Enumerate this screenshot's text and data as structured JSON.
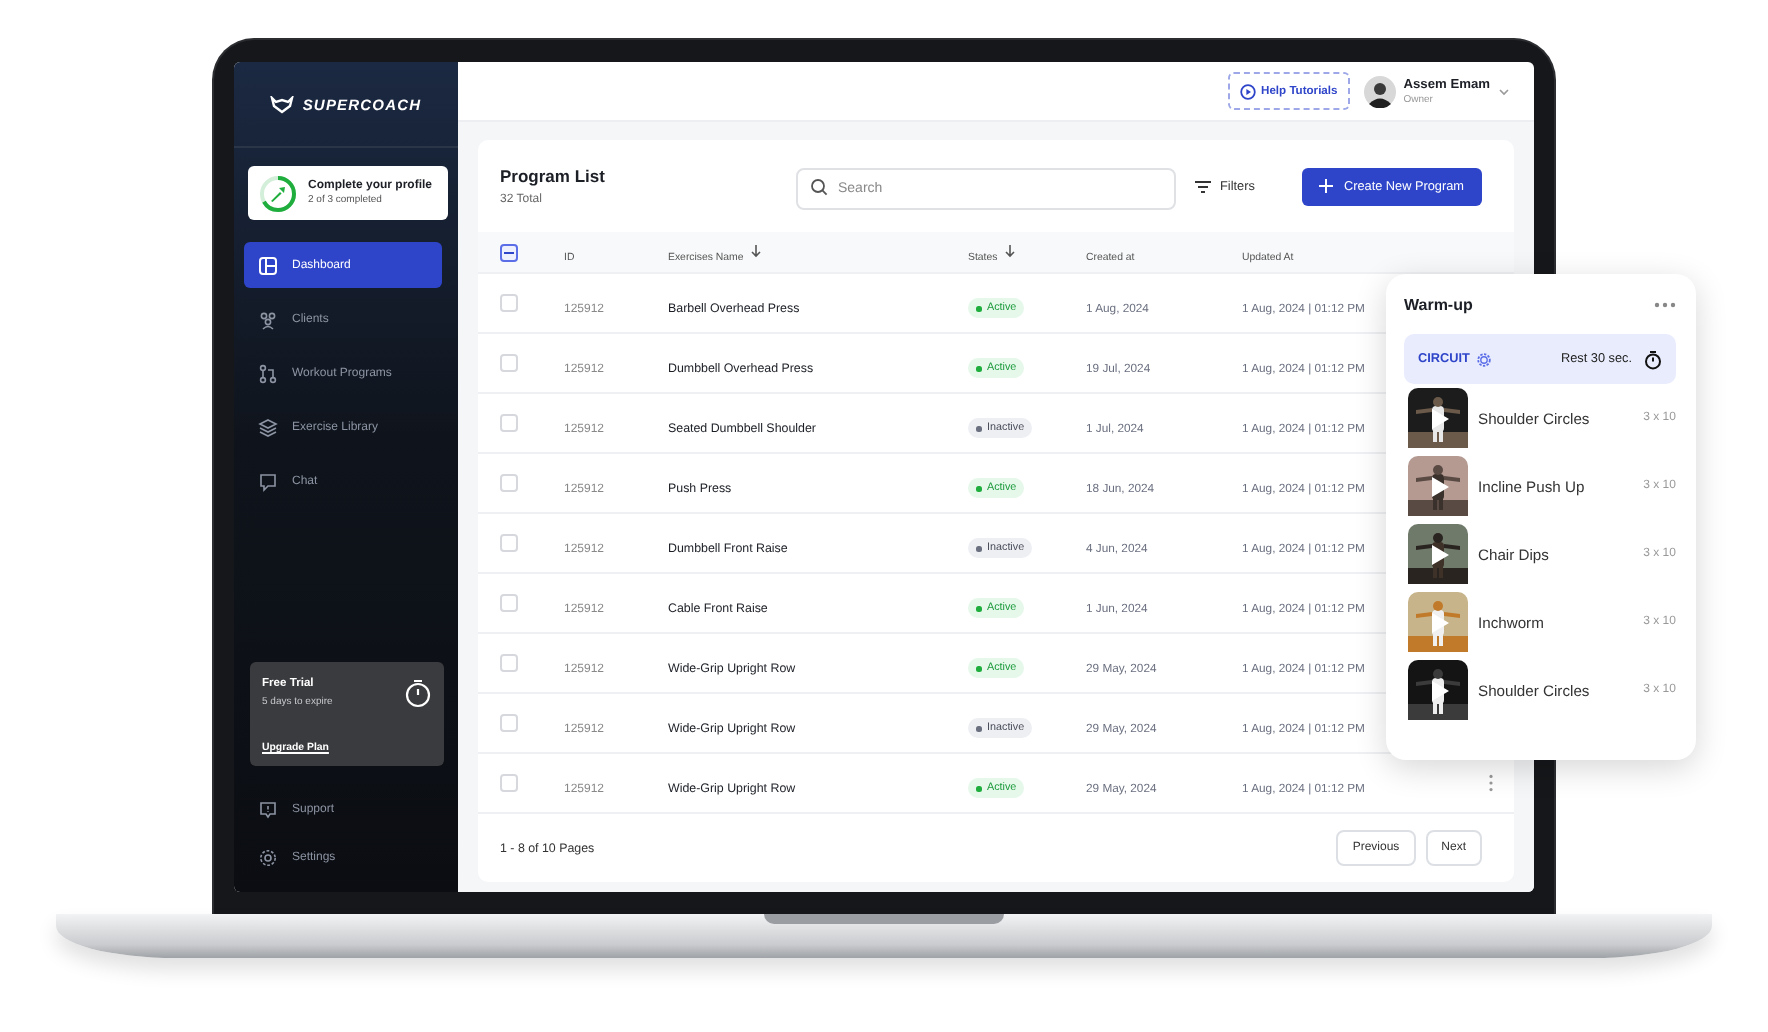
{
  "brand": {
    "name": "SUPERCOACH"
  },
  "profile_card": {
    "title": "Complete your profile",
    "subtitle": "2 of 3 completed",
    "level": 0.67
  },
  "sidebar": {
    "items": [
      {
        "label": "Dashboard",
        "kind": "dashboard",
        "selected": true
      },
      {
        "label": "Clients",
        "kind": "clients",
        "selected": false
      },
      {
        "label": "Workout Programs",
        "kind": "programs",
        "selected": false
      },
      {
        "label": "Exercise Library",
        "kind": "library",
        "selected": false
      },
      {
        "label": "Chat",
        "kind": "chat",
        "selected": false
      }
    ]
  },
  "trial": {
    "title": "Free Trial",
    "subtitle": "5 days to expire",
    "link": "Upgrade Plan"
  },
  "sidebar_footer": [
    {
      "label": "Support",
      "kind": "support"
    },
    {
      "label": "Settings",
      "kind": "settings"
    }
  ],
  "header": {
    "help": "Help Tutorials",
    "user": {
      "name": "Assem Emam",
      "role": "Owner"
    }
  },
  "program_list": {
    "title": "Program List",
    "total": "32 Total",
    "search": {
      "placeholder": "Search"
    },
    "filters": "Filters",
    "create_button": "Create New Program",
    "header_checked": true,
    "columns": [
      {
        "label": "ID",
        "sortable": false
      },
      {
        "label": "Exercises Name",
        "sortable": true
      },
      {
        "label": "States",
        "sortable": true
      },
      {
        "label": "Created at",
        "sortable": false
      },
      {
        "label": "Updated At",
        "sortable": false
      }
    ],
    "rows": [
      {
        "id": "125912",
        "name": "Barbell Overhead Press",
        "status": {
          "label": "Active",
          "kind": "active"
        },
        "created": "1 Aug, 2024",
        "updated": "1 Aug, 2024 | 01:12 PM",
        "checked": false
      },
      {
        "id": "125912",
        "name": "Dumbbell Overhead Press",
        "status": {
          "label": "Active",
          "kind": "active"
        },
        "created": "19 Jul, 2024",
        "updated": "1 Aug, 2024 | 01:12 PM",
        "checked": false
      },
      {
        "id": "125912",
        "name": "Seated Dumbbell Shoulder",
        "status": {
          "label": "Inactive",
          "kind": "inactive"
        },
        "created": "1 Jul, 2024",
        "updated": "1 Aug, 2024 | 01:12 PM",
        "checked": false
      },
      {
        "id": "125912",
        "name": "Push Press",
        "status": {
          "label": "Active",
          "kind": "active"
        },
        "created": "18 Jun, 2024",
        "updated": "1 Aug, 2024 | 01:12 PM",
        "checked": false
      },
      {
        "id": "125912",
        "name": "Dumbbell Front Raise",
        "status": {
          "label": "Inactive",
          "kind": "inactive"
        },
        "created": "4 Jun, 2024",
        "updated": "1 Aug, 2024 | 01:12 PM",
        "checked": false
      },
      {
        "id": "125912",
        "name": "Cable Front Raise",
        "status": {
          "label": "Active",
          "kind": "active"
        },
        "created": "1 Jun, 2024",
        "updated": "1 Aug, 2024 | 01:12 PM",
        "checked": false
      },
      {
        "id": "125912",
        "name": "Wide-Grip Upright Row",
        "status": {
          "label": "Active",
          "kind": "active"
        },
        "created": "29 May, 2024",
        "updated": "1 Aug, 2024 | 01:12 PM",
        "checked": false
      },
      {
        "id": "125912",
        "name": "Wide-Grip Upright Row",
        "status": {
          "label": "Inactive",
          "kind": "inactive"
        },
        "created": "29 May, 2024",
        "updated": "1 Aug, 2024 | 01:12 PM",
        "checked": false
      },
      {
        "id": "125912",
        "name": "Wide-Grip Upright Row",
        "status": {
          "label": "Active",
          "kind": "active"
        },
        "created": "29 May, 2024",
        "updated": "1 Aug, 2024 | 01:12 PM",
        "checked": false
      }
    ],
    "pagination": {
      "summary": "1 - 8 of 10 Pages",
      "previous": "Previous",
      "next": "Next"
    }
  },
  "circuit_card": {
    "title": "Warm-up",
    "tag": "CIRCUIT",
    "rest": "Rest 30 sec.",
    "exercises": [
      {
        "name": "Shoulder Circles",
        "sets": "3 x 10"
      },
      {
        "name": "Incline Push Up",
        "sets": "3 x 10"
      },
      {
        "name": "Chair Dips",
        "sets": "3 x 10"
      },
      {
        "name": "Inchworm",
        "sets": "3 x 10"
      },
      {
        "name": "Shoulder Circles",
        "sets": "3 x 10"
      }
    ]
  }
}
